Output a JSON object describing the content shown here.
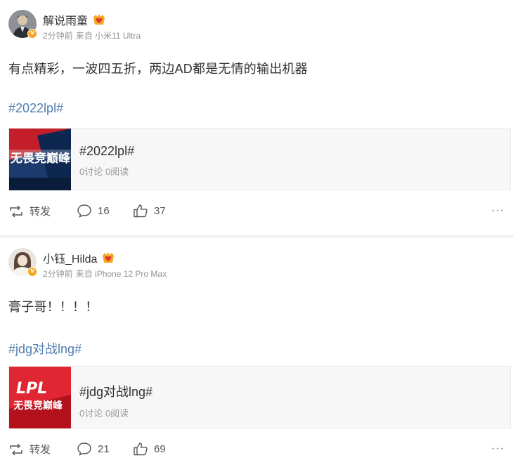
{
  "posts": [
    {
      "username": "解说雨童",
      "time": "2分钟前",
      "source": "来自 小米11 Ultra",
      "content": "有点精彩，一波四五折，两边AD都是无情的输出机器",
      "hashtag": "#2022lpl#",
      "card": {
        "title": "#2022lpl#",
        "stats": "0讨论 0阅读",
        "thumb_text": "无畏竞巅峰"
      },
      "actions": {
        "repost_label": "转发",
        "comments": "16",
        "likes": "37",
        "more": "···"
      }
    },
    {
      "username": "小钰_Hilda",
      "time": "2分钟前",
      "source": "来自 iPhone 12 Pro Max",
      "content": "膏子哥！！！！",
      "hashtag": "#jdg对战lng#",
      "card": {
        "title": "#jdg对战lng#",
        "stats": "0讨论 0阅读",
        "thumb_logo": "LPL",
        "thumb_text": "无畏竞巅峰"
      },
      "actions": {
        "repost_label": "转发",
        "comments": "21",
        "likes": "69",
        "more": "···"
      }
    }
  ],
  "verified_badge": "v",
  "colors": {
    "hashtag": "#507daf",
    "badge": "#f5a623",
    "card_bg": "#f7f7f7"
  },
  "icons": [
    "avatar",
    "verified-badge-icon",
    "crown-vip-icon",
    "repost-icon",
    "comment-icon",
    "like-icon",
    "more-icon"
  ]
}
